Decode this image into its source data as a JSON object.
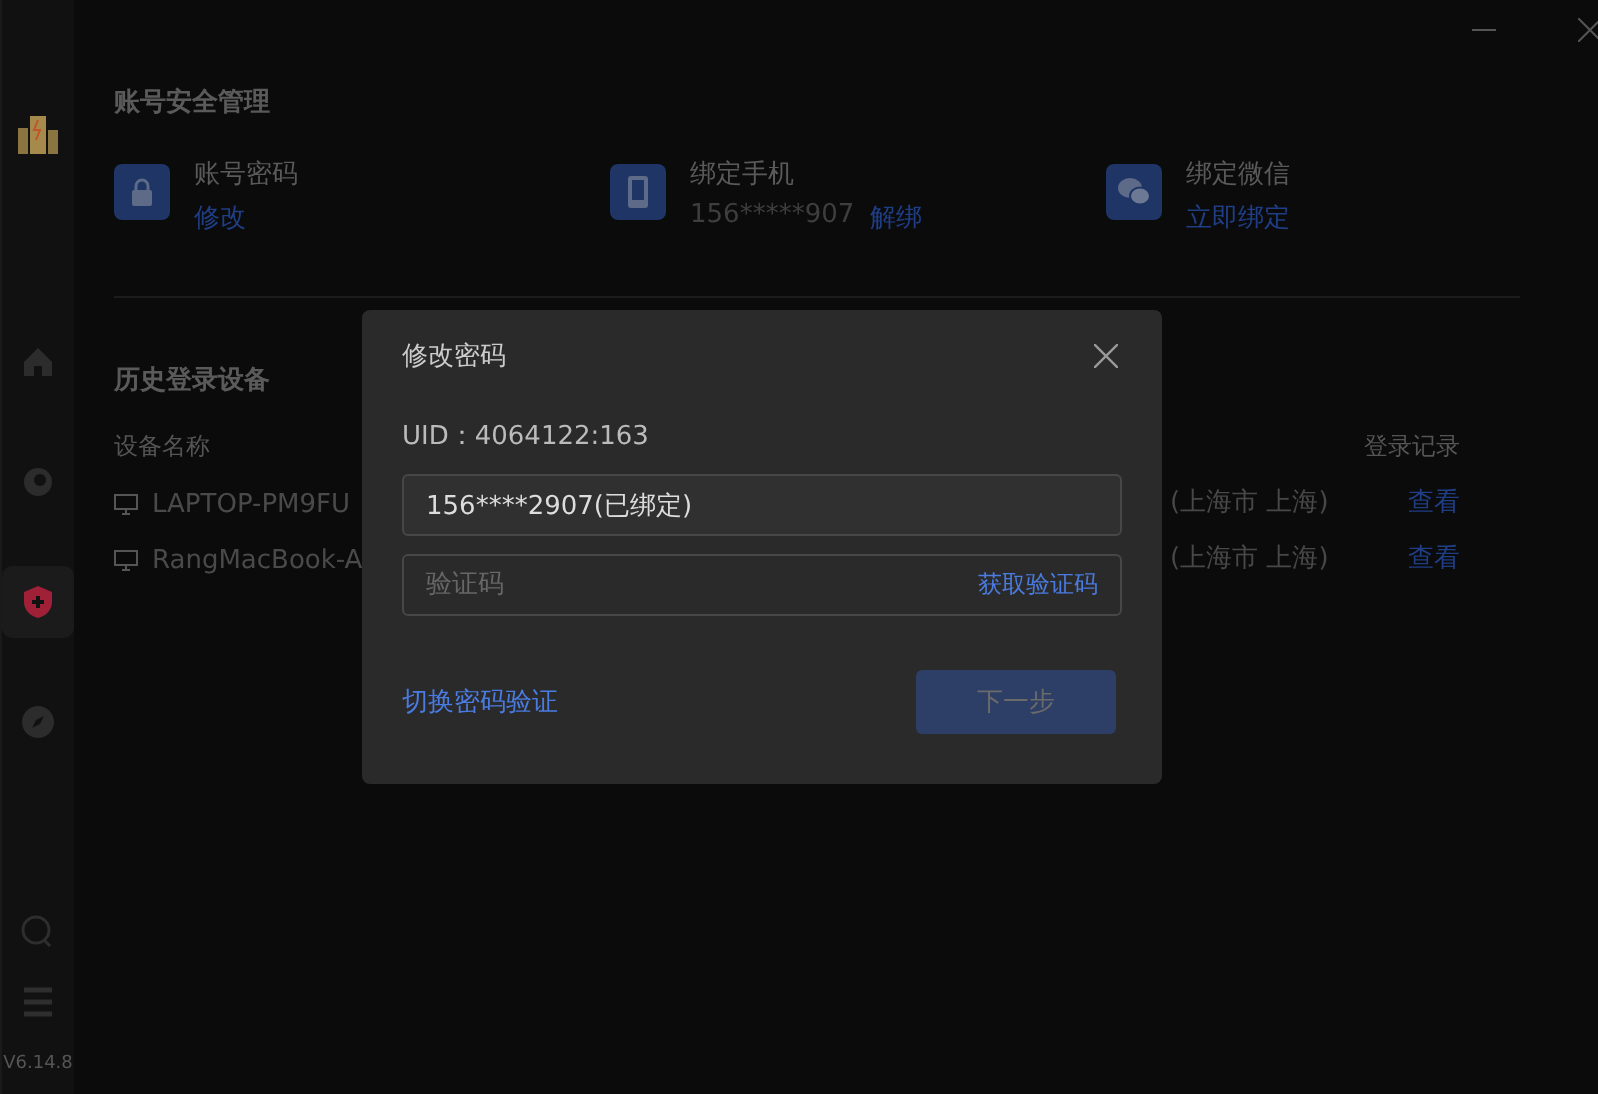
{
  "sidebar": {
    "nav": [
      {
        "selected": false
      },
      {
        "selected": false
      },
      {
        "selected": true
      },
      {
        "selected": false
      }
    ],
    "version": "V6.14.8"
  },
  "security": {
    "title": "账号安全管理",
    "items": [
      {
        "label": "账号密码",
        "action": "修改"
      },
      {
        "label": "绑定手机",
        "value": "156*****907",
        "action": "解绑"
      },
      {
        "label": "绑定微信",
        "action": "立即绑定"
      }
    ]
  },
  "devices": {
    "title": "历史登录设备",
    "columns": [
      "设备名称",
      "登录记录"
    ],
    "rows": [
      {
        "name": "LAPTOP-PM9FU",
        "location": "(上海市 上海)",
        "action": "查看"
      },
      {
        "name": "RangMacBook-A",
        "location": "(上海市 上海)",
        "action": "查看"
      }
    ]
  },
  "dialog": {
    "title": "修改密码",
    "uid": "UID：4064122:163",
    "phone": {
      "value": "156****2907(已绑定)"
    },
    "code": {
      "placeholder": "验证码",
      "action": "获取验证码"
    },
    "switch_link": "切换密码验证",
    "next_button": {
      "label": "下一步",
      "disabled": true
    }
  }
}
